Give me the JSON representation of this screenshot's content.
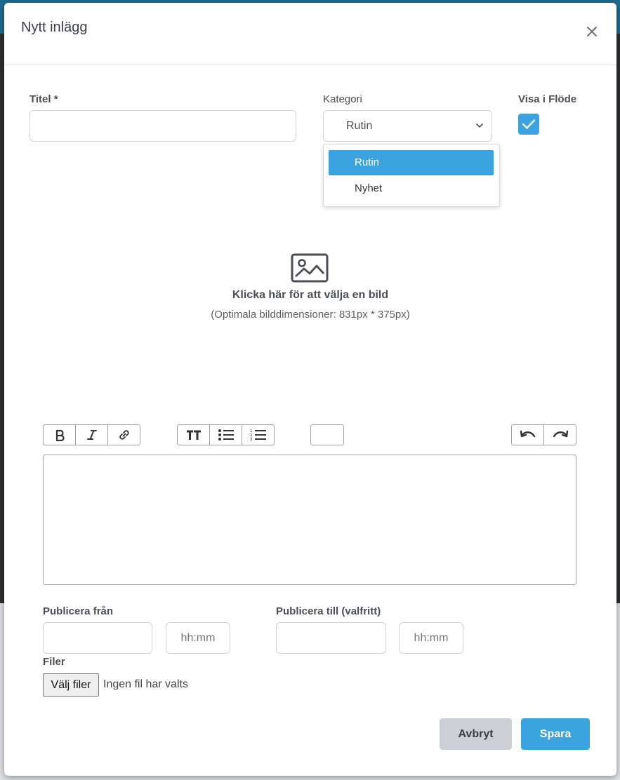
{
  "modal": {
    "title": "Nytt inlägg",
    "close_icon": "close-icon"
  },
  "form": {
    "title_label": "Titel *",
    "title_value": "",
    "category_label": "Kategori",
    "category_selected": "Rutin",
    "category_options": [
      "Rutin",
      "Nyhet"
    ],
    "show_in_feed_label": "Visa i Flöde",
    "show_in_feed_checked": true
  },
  "image_picker": {
    "icon": "image-icon",
    "text": "Klicka här för att välja en bild",
    "hint": "(Optimala bilddimensioner: 831px * 375px)"
  },
  "toolbar": {
    "icons": [
      "bold-icon",
      "italic-icon",
      "link-icon",
      "text-size-icon",
      "bulleted-list-icon",
      "numbered-list-icon",
      "color-picker",
      "undo-icon",
      "redo-icon"
    ]
  },
  "publish": {
    "from_label": "Publicera från",
    "from_date": "",
    "from_time_placeholder": "hh:mm",
    "to_label": "Publicera till (valfritt)",
    "to_date": "",
    "to_time_placeholder": "hh:mm"
  },
  "files": {
    "label": "Filer",
    "button_label": "Välj filer",
    "status": "Ingen fil har valts"
  },
  "actions": {
    "cancel_label": "Avbryt",
    "save_label": "Spara"
  },
  "colors": {
    "accent": "#3aa3e0",
    "cancel_bg": "#ccd0d6"
  }
}
